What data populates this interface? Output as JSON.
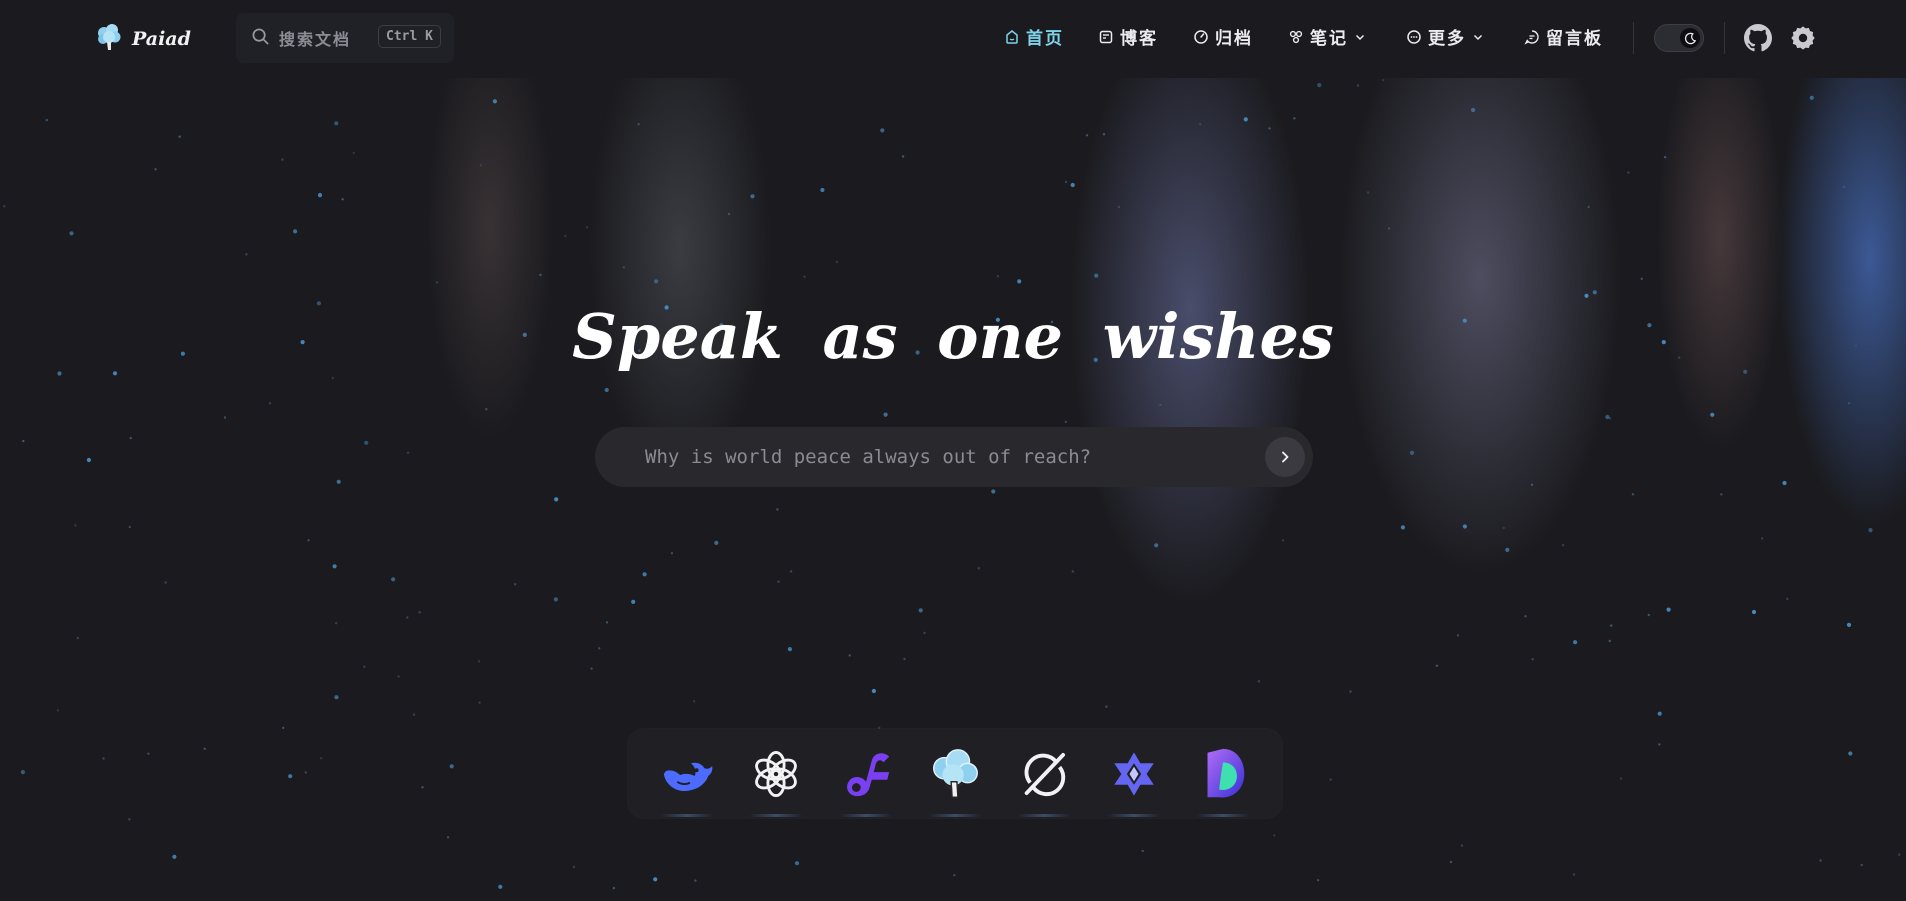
{
  "brand": {
    "name": "Paiad",
    "logo_icon": "tree-icon"
  },
  "search": {
    "placeholder": "搜索文档",
    "shortcut": "Ctrl K"
  },
  "nav": {
    "items": [
      {
        "label": "首页",
        "icon": "home-icon",
        "active": true
      },
      {
        "label": "博客",
        "icon": "blog-icon",
        "active": false
      },
      {
        "label": "归档",
        "icon": "archive-icon",
        "active": false
      },
      {
        "label": "笔记",
        "icon": "notes-icon",
        "active": false,
        "dropdown": true
      },
      {
        "label": "更多",
        "icon": "more-icon",
        "active": false,
        "dropdown": true
      },
      {
        "label": "留言板",
        "icon": "message-icon",
        "active": false
      }
    ],
    "theme_toggle": "dark",
    "github_icon": "github-icon",
    "settings_icon": "gear-icon"
  },
  "hero": {
    "title": "Speak as one wishes",
    "input_placeholder": "Why is world peace always out of reach?"
  },
  "dock": {
    "items": [
      "deepseek-icon",
      "openai-icon",
      "flowith-icon",
      "paiad-tree-icon",
      "grok-icon",
      "qwen-icon",
      "kimi-icon"
    ]
  },
  "colors": {
    "accent": "#7dd3e8",
    "background": "#1b1b1f"
  }
}
